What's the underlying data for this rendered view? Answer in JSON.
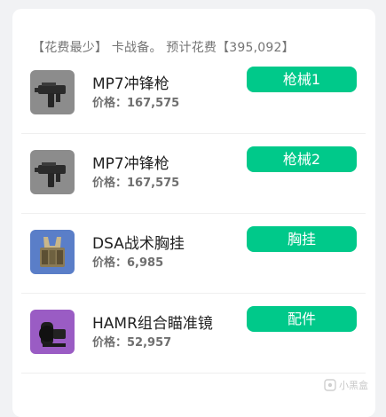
{
  "summary": "【花费最少】 卡战备。 预计花费【395,092】",
  "items": [
    {
      "name": "MP7冲锋枪",
      "price_label": "价格：",
      "price": "167,575",
      "slot": "枪械1",
      "icon": "smg-icon"
    },
    {
      "name": "MP7冲锋枪",
      "price_label": "价格：",
      "price": "167,575",
      "slot": "枪械2",
      "icon": "smg-icon"
    },
    {
      "name": "DSA战术胸挂",
      "price_label": "价格：",
      "price": "6,985",
      "slot": "胸挂",
      "icon": "chest-rig-icon"
    },
    {
      "name": "HAMR组合瞄准镜",
      "price_label": "价格：",
      "price": "52,957",
      "slot": "配件",
      "icon": "scope-icon"
    }
  ],
  "colors": {
    "accent": "#00c98a",
    "card_bg": "#ffffff",
    "page_bg": "#f1f2f4"
  },
  "watermark": "小黑盒"
}
